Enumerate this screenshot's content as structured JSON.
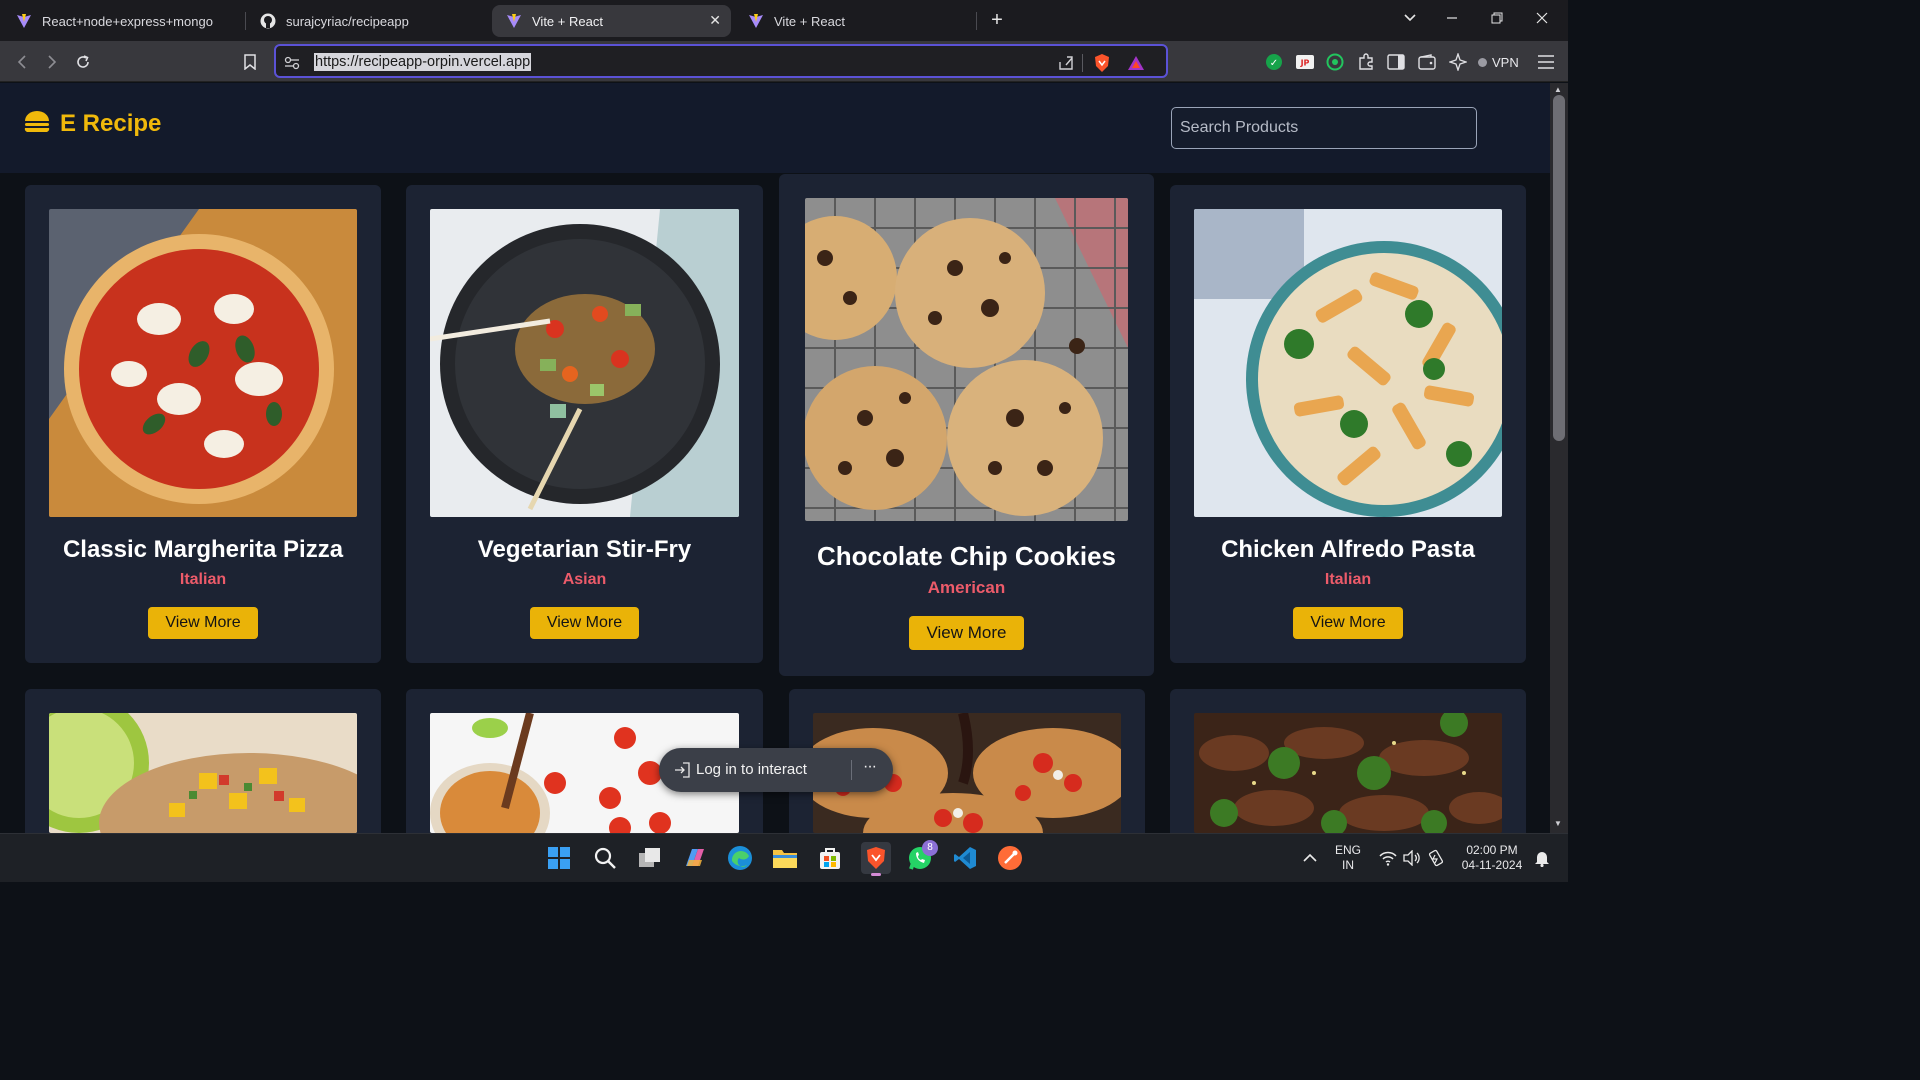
{
  "browser": {
    "tabs": [
      {
        "title": "React+node+express+mongo",
        "active": false
      },
      {
        "title": "surajcyriac/recipeapp",
        "active": false
      },
      {
        "title": "Vite + React",
        "active": true
      },
      {
        "title": "Vite + React",
        "active": false
      }
    ],
    "url": "https://recipeapp-orpin.vercel.app",
    "vpn_label": "VPN",
    "accent": "#5b52d6"
  },
  "site": {
    "brand": "E Recipe",
    "brand_color": "#f0b90b",
    "search_placeholder": "Search Products"
  },
  "recipes": [
    {
      "title": "Classic Margherita Pizza",
      "cuisine": "Italian",
      "button": "View More",
      "image": "pizza"
    },
    {
      "title": "Vegetarian Stir-Fry",
      "cuisine": "Asian",
      "button": "View More",
      "image": "stir-fry"
    },
    {
      "title": "Chocolate Chip Cookies",
      "cuisine": "American",
      "button": "View More",
      "image": "cookies"
    },
    {
      "title": "Chicken Alfredo Pasta",
      "cuisine": "Italian",
      "button": "View More",
      "image": "pasta"
    },
    {
      "image": "mango-salsa"
    },
    {
      "image": "tomato-sauce"
    },
    {
      "image": "bruschetta"
    },
    {
      "image": "beef-broccoli"
    }
  ],
  "toast": {
    "label": "Log in to interact",
    "more": "···"
  },
  "taskbar": {
    "lang_top": "ENG",
    "lang_bottom": "IN",
    "time": "02:00 PM",
    "date": "04-11-2024",
    "whatsapp_badge": "8"
  }
}
